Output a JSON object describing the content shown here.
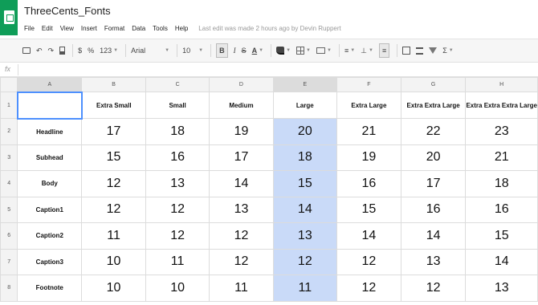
{
  "app": {
    "title": "ThreeCents_Fonts",
    "last_edit": "Last edit was made 2 hours ago by Devin Ruppert",
    "menu": [
      "File",
      "Edit",
      "View",
      "Insert",
      "Format",
      "Data",
      "Tools",
      "Help"
    ]
  },
  "toolbar": {
    "currency": "$",
    "percent": "%",
    "number_format": "123",
    "font": "Arial",
    "font_size": "10",
    "bold": "B",
    "italic": "I",
    "strike": "S",
    "text_color": "A",
    "sum": "Σ"
  },
  "formula": {
    "fx": "fx",
    "value": ""
  },
  "columns": [
    "A",
    "B",
    "C",
    "D",
    "E",
    "F",
    "G",
    "H"
  ],
  "size_headers": [
    "Extra Small",
    "Small",
    "Medium",
    "Large",
    "Extra Large",
    "Extra Extra Large",
    "Extra Extra Extra Large"
  ],
  "rows": [
    {
      "num": "2",
      "label": "Headline",
      "values": [
        "17",
        "18",
        "19",
        "20",
        "21",
        "22",
        "23"
      ]
    },
    {
      "num": "3",
      "label": "Subhead",
      "values": [
        "15",
        "16",
        "17",
        "18",
        "19",
        "20",
        "21"
      ]
    },
    {
      "num": "4",
      "label": "Body",
      "values": [
        "12",
        "13",
        "14",
        "15",
        "16",
        "17",
        "18"
      ]
    },
    {
      "num": "5",
      "label": "Caption1",
      "values": [
        "12",
        "12",
        "13",
        "14",
        "15",
        "16",
        "16"
      ]
    },
    {
      "num": "6",
      "label": "Caption2",
      "values": [
        "11",
        "12",
        "12",
        "13",
        "14",
        "14",
        "15"
      ]
    },
    {
      "num": "7",
      "label": "Caption3",
      "values": [
        "10",
        "11",
        "12",
        "12",
        "12",
        "13",
        "14"
      ]
    },
    {
      "num": "8",
      "label": "Footnote",
      "values": [
        "10",
        "10",
        "11",
        "11",
        "12",
        "12",
        "13"
      ]
    }
  ],
  "header_row_num": "1",
  "selected_column_color": "#c9daf8",
  "active_cell_border": "#4d90fe",
  "brand_color": "#0f9d58"
}
